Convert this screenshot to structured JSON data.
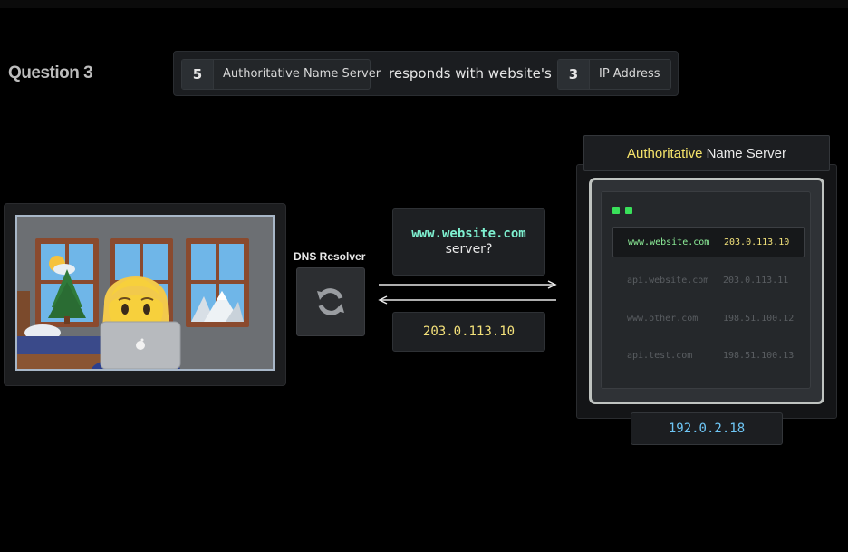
{
  "question": {
    "title": "Question 3"
  },
  "question_bar": {
    "left": {
      "number": "5",
      "label": "Authoritative Name Server"
    },
    "middle": "responds with website's",
    "right": {
      "number": "3",
      "label": "IP Address"
    }
  },
  "resolver": {
    "label": "DNS Resolver",
    "icon": "refresh-icon"
  },
  "query": {
    "domain": "www.website.com",
    "suffix": "server?"
  },
  "answer": {
    "ip": "203.0.113.10"
  },
  "server": {
    "title_highlight": "Authoritative",
    "title_rest": " Name Server",
    "records": [
      {
        "domain": "www.website.com",
        "ip": "203.0.113.10",
        "active": true
      },
      {
        "domain": "api.website.com",
        "ip": "203.0.113.11",
        "active": false
      },
      {
        "domain": "www.other.com",
        "ip": "198.51.100.12",
        "active": false
      },
      {
        "domain": "api.test.com",
        "ip": "198.51.100.13",
        "active": false
      }
    ],
    "ip": "192.0.2.18"
  },
  "colors": {
    "domain_green": "#7ef0d0",
    "ip_yellow": "#f4e17a",
    "server_ip_blue": "#6ec6f5",
    "led_green": "#39e05a"
  }
}
